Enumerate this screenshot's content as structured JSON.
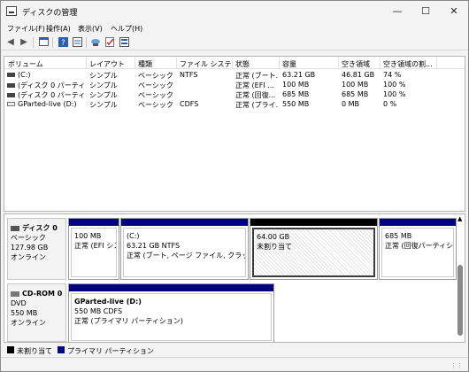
{
  "window": {
    "title": "ディスクの管理",
    "min": "—",
    "max": "☐",
    "close": "✕"
  },
  "menu": [
    "ファイル(F)",
    "操作(A)",
    "表示(V)",
    "ヘルプ(H)"
  ],
  "toolbar_icons": [
    "back-arrow-icon",
    "forward-arrow-icon",
    "console-tree-icon",
    "help-icon",
    "properties-icon",
    "rescan-icon",
    "check-icon",
    "list-icon"
  ],
  "columns": [
    "ボリューム",
    "レイアウト",
    "種類",
    "ファイル システム",
    "状態",
    "容量",
    "空き領域",
    "空き領域の割..."
  ],
  "volumes": [
    {
      "name": "(C:)",
      "layout": "シンプル",
      "type": "ベーシック",
      "fs": "NTFS",
      "status": "正常 (ブート...",
      "capacity": "63.21 GB",
      "free": "46.81 GB",
      "pct": "74 %"
    },
    {
      "name": "(ディスク 0 パーティシ...",
      "layout": "シンプル",
      "type": "ベーシック",
      "fs": "",
      "status": "正常 (EFI ...",
      "capacity": "100 MB",
      "free": "100 MB",
      "pct": "100 %"
    },
    {
      "name": "(ディスク 0 パーティシ...",
      "layout": "シンプル",
      "type": "ベーシック",
      "fs": "",
      "status": "正常 (回復...",
      "capacity": "685 MB",
      "free": "685 MB",
      "pct": "100 %"
    },
    {
      "name": "GParted-live (D:)",
      "layout": "シンプル",
      "type": "ベーシック",
      "fs": "CDFS",
      "status": "正常 (プライ...",
      "capacity": "550 MB",
      "free": "0 MB",
      "pct": "0 %"
    }
  ],
  "disks": [
    {
      "name": "ディスク 0",
      "type": "ベーシック",
      "size": "127.98 GB",
      "state": "オンライン",
      "partitions": [
        {
          "title": "",
          "size": "100 MB",
          "status": "正常 (EFI シス"
        },
        {
          "title": "(C:)",
          "size": "63.21 GB NTFS",
          "status": "正常 (ブート, ページ ファイル, クラッシュ ダン"
        },
        {
          "title": "",
          "size": "64.00 GB",
          "status": "未割り当て"
        },
        {
          "title": "",
          "size": "685 MB",
          "status": "正常 (回復パーティション"
        }
      ]
    },
    {
      "name": "CD-ROM 0",
      "type": "DVD",
      "size": "550 MB",
      "state": "オンライン",
      "partitions": [
        {
          "title": "GParted-live  (D:)",
          "size": "550 MB CDFS",
          "status": "正常 (プライマリ パーティション)"
        }
      ]
    }
  ],
  "legend": [
    "未割り当て",
    "プライマリ パーティション"
  ],
  "colors": {
    "primary": "#000080",
    "unallocated": "#000000"
  }
}
